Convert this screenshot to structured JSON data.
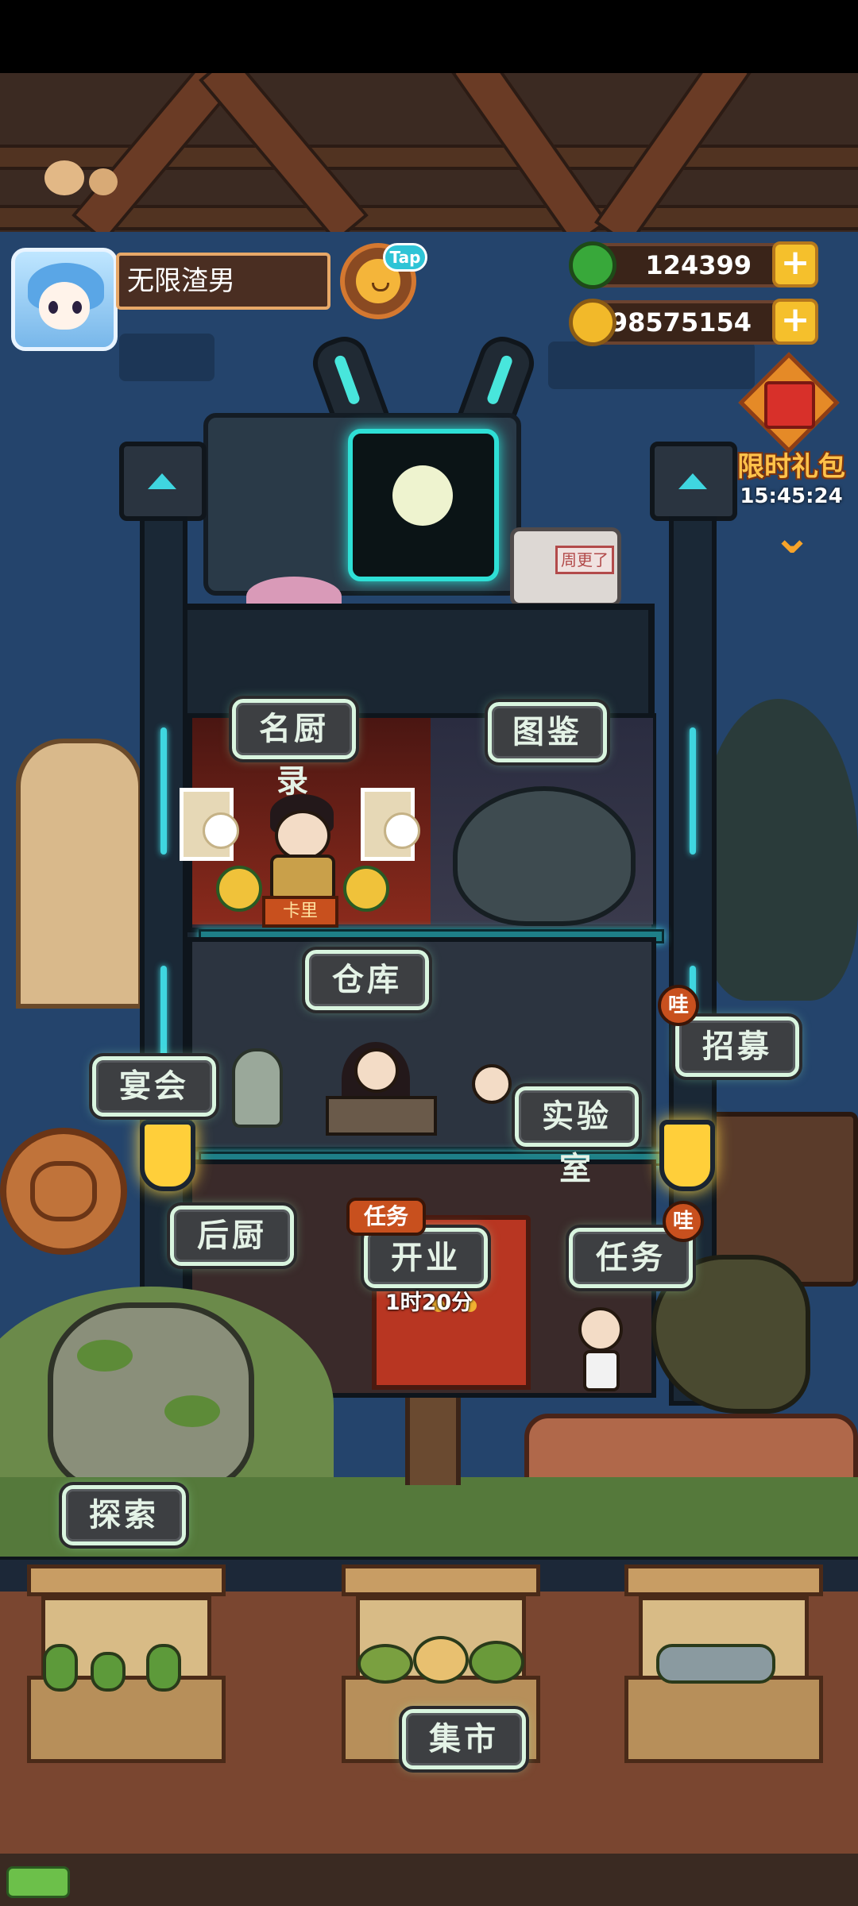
{
  "player": {
    "name": "无限渣男",
    "tap_badge": "Tap"
  },
  "currency": {
    "gems": "124399",
    "coins": "98575154",
    "add_symbol": "+"
  },
  "limited_pack": {
    "label": "限时礼包",
    "timer": "15:45:24"
  },
  "signs": {
    "chef_list": "名厨录",
    "compendium": "图鉴",
    "warehouse": "仓库",
    "recruit": "招募",
    "banquet": "宴会",
    "laboratory": "实验室",
    "kitchen": "后厨",
    "open_business": "开业",
    "tasks": "任务",
    "explore": "探索",
    "market": "集市"
  },
  "badges": {
    "recruit": "哇",
    "tasks": "哇",
    "open_task_tag": "任务"
  },
  "open_timer": "1时20分",
  "decor": {
    "truck_label": "周更了",
    "chef_nameplate": "卡里"
  },
  "colors": {
    "neon": "#3fd6e0",
    "sign_bg": "#3d3f42",
    "sign_text": "#e4f2e6",
    "badge": "#c8501e",
    "coin_gold": "#f5c02c",
    "gift_text": "#ffc24a"
  },
  "icons": {
    "avatar": "player-avatar",
    "tap": "chick-icon",
    "gem": "green-orb-icon",
    "coin": "gold-coin-icon",
    "gift": "gift-box-icon",
    "expand": "chevron-down-icon"
  }
}
